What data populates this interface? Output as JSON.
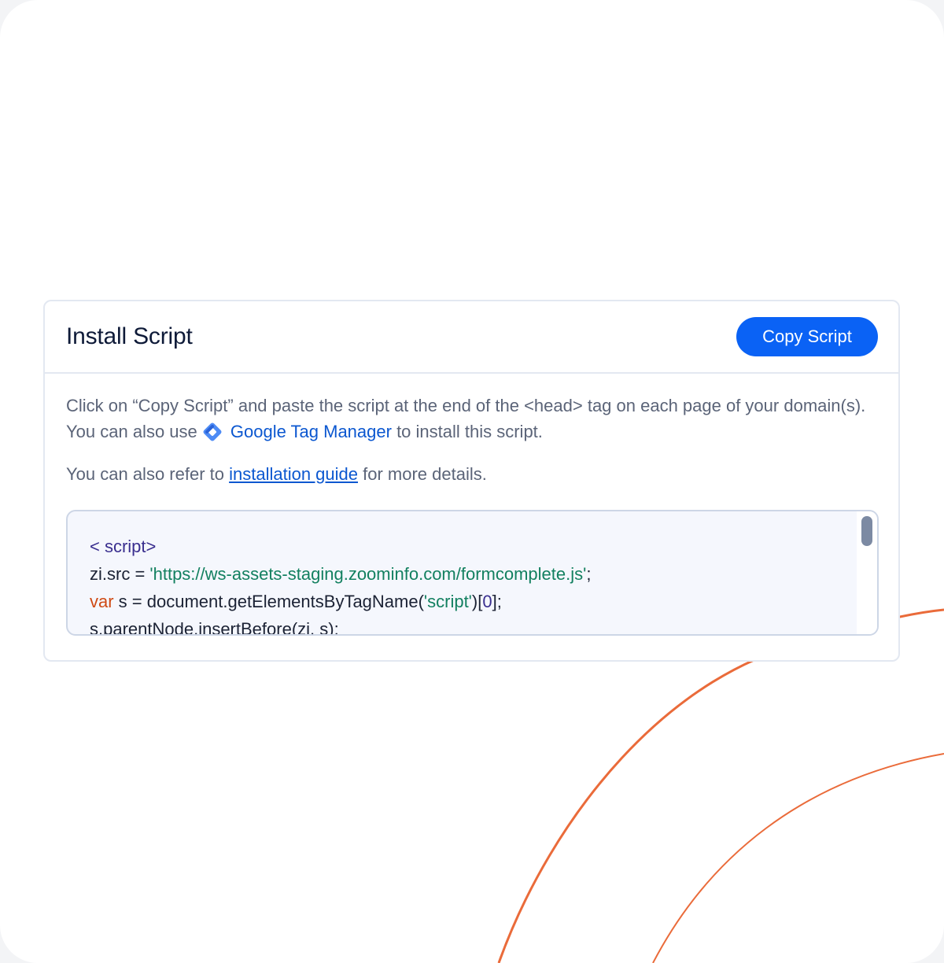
{
  "card": {
    "title": "Install Script",
    "copy_button_label": "Copy Script",
    "description": {
      "text_before": "Click on “Copy Script” and paste the script at the end of the <head> tag on each page of your domain(s). You can also use ",
      "gtm_icon": "google-tag-manager-icon",
      "gtm_link_label": "Google Tag Manager",
      "text_after": "  to install this script."
    },
    "guide": {
      "text_before": "You can also refer to ",
      "link_label": "installation guide",
      "text_after": " for more details."
    },
    "code": {
      "line1_tag": "< script>",
      "line2_prefix": "zi.src = ",
      "line2_string": "'https://ws-assets-staging.zoominfo.com/formcomplete.js'",
      "line2_suffix": ";",
      "line3_keyword": "var",
      "line3_mid": " s = document.getElementsByTagName(",
      "line3_string": "'script'",
      "line3_bracket_open": ")[",
      "line3_number": "0",
      "line3_end": "];",
      "line4": "s.parentNode.insertBefore(zi, s);"
    }
  },
  "colors": {
    "primary_button": "#0a62f5",
    "link": "#0b57d0",
    "decor_arc": "#ea6b3a",
    "title": "#0e1a38",
    "body_text": "#5b6478"
  }
}
